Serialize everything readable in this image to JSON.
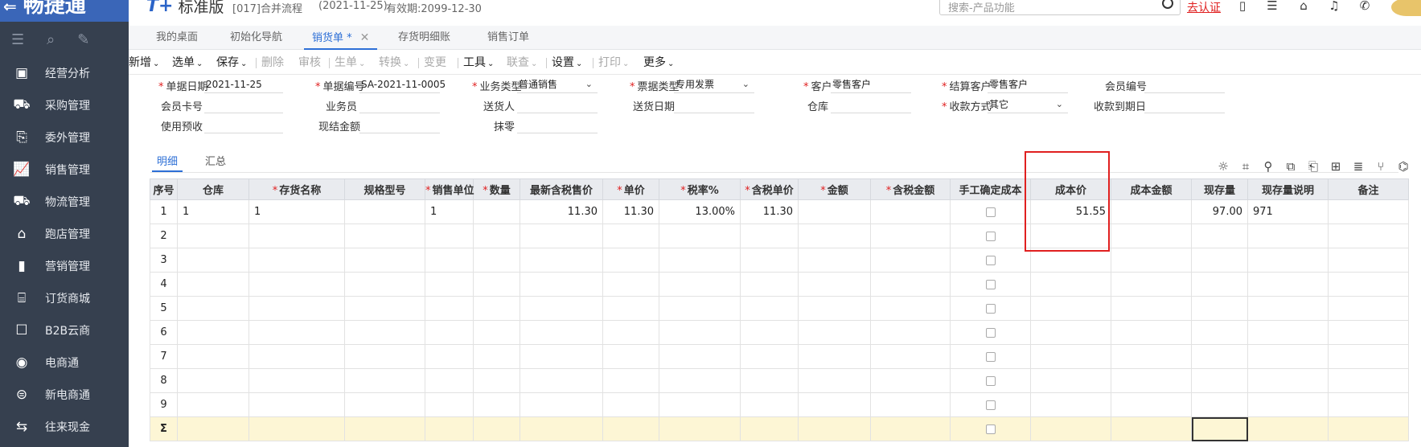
{
  "header": {
    "brand": "畅捷通",
    "edition_logo": "T+",
    "edition_name": "标准版",
    "account": "[017]合并流程",
    "date": "(2021-11-25)",
    "validity": "有效期:2099-12-30",
    "search_placeholder": "搜索-产品功能",
    "auth_link": "去认证"
  },
  "sidebar": {
    "items": [
      {
        "label": "经营分析",
        "icon": "monitor-chart-icon",
        "glyph": "▣"
      },
      {
        "label": "采购管理",
        "icon": "cart-icon",
        "glyph": "⛟"
      },
      {
        "label": "委外管理",
        "icon": "outsource-icon",
        "glyph": "⎘"
      },
      {
        "label": "销售管理",
        "icon": "sales-chart-icon",
        "glyph": "📈"
      },
      {
        "label": "物流管理",
        "icon": "truck-icon",
        "glyph": "⛟"
      },
      {
        "label": "跑店管理",
        "icon": "store-icon",
        "glyph": "⌂"
      },
      {
        "label": "营销管理",
        "icon": "bar-chart-icon",
        "glyph": "▮"
      },
      {
        "label": "订货商城",
        "icon": "shop-icon",
        "glyph": "⌸"
      },
      {
        "label": "B2B云商",
        "icon": "bag-icon",
        "glyph": "☐"
      },
      {
        "label": "电商通",
        "icon": "ecommerce-icon",
        "glyph": "◉"
      },
      {
        "label": "新电商通",
        "icon": "new-ecommerce-icon",
        "glyph": "⊜"
      },
      {
        "label": "往来现金",
        "icon": "exchange-icon",
        "glyph": "⇆"
      }
    ]
  },
  "tabs": [
    {
      "label": "我的桌面"
    },
    {
      "label": "初始化导航"
    },
    {
      "label": "销货单 *"
    },
    {
      "label": "存货明细账"
    },
    {
      "label": "销售订单"
    }
  ],
  "toolbar": [
    {
      "label": "新增",
      "dropdown": true,
      "disabled": false
    },
    {
      "label": "选单",
      "dropdown": true,
      "disabled": false
    },
    {
      "label": "保存",
      "dropdown": true,
      "disabled": false
    },
    {
      "label": "删除",
      "dropdown": false,
      "disabled": true
    },
    {
      "label": "审核",
      "dropdown": false,
      "disabled": true
    },
    {
      "label": "生单",
      "dropdown": true,
      "disabled": true
    },
    {
      "label": "转换",
      "dropdown": true,
      "disabled": true
    },
    {
      "label": "变更",
      "dropdown": false,
      "disabled": true
    },
    {
      "label": "工具",
      "dropdown": true,
      "disabled": false
    },
    {
      "label": "联查",
      "dropdown": true,
      "disabled": true
    },
    {
      "label": "设置",
      "dropdown": true,
      "disabled": false
    },
    {
      "label": "打印",
      "dropdown": true,
      "disabled": true
    },
    {
      "label": "更多",
      "dropdown": true,
      "disabled": false
    }
  ],
  "form": {
    "doc_date": {
      "label": "单据日期",
      "value": "2021-11-25"
    },
    "doc_no": {
      "label": "单据编号",
      "value": "SA-2021-11-0005"
    },
    "biz_type": {
      "label": "业务类型",
      "value": "普通销售"
    },
    "invoice_type": {
      "label": "票据类型",
      "value": "专用发票"
    },
    "customer": {
      "label": "客户",
      "value": "零售客户"
    },
    "settle_customer": {
      "label": "结算客户",
      "value": "零售客户"
    },
    "member_no": {
      "label": "会员编号",
      "value": ""
    },
    "member_card": {
      "label": "会员卡号",
      "value": ""
    },
    "salesman": {
      "label": "业务员",
      "value": ""
    },
    "deliverer": {
      "label": "送货人",
      "value": ""
    },
    "delivery_date": {
      "label": "送货日期",
      "value": ""
    },
    "warehouse": {
      "label": "仓库",
      "value": ""
    },
    "payment_method": {
      "label": "收款方式",
      "value": "其它"
    },
    "due_date": {
      "label": "收款到期日",
      "value": ""
    },
    "use_prepay": {
      "label": "使用预收",
      "value": ""
    },
    "cash_amount": {
      "label": "现结金额",
      "value": ""
    },
    "round_off": {
      "label": "抹零",
      "value": ""
    }
  },
  "subtabs": [
    {
      "label": "明细"
    },
    {
      "label": "汇总"
    }
  ],
  "grid": {
    "columns": [
      {
        "label": "序号",
        "required": false
      },
      {
        "label": "仓库",
        "required": false
      },
      {
        "label": "存货名称",
        "required": true
      },
      {
        "label": "规格型号",
        "required": false
      },
      {
        "label": "销售单位",
        "required": true
      },
      {
        "label": "数量",
        "required": true
      },
      {
        "label": "最新含税售价",
        "required": false
      },
      {
        "label": "单价",
        "required": true
      },
      {
        "label": "税率%",
        "required": true
      },
      {
        "label": "含税单价",
        "required": true
      },
      {
        "label": "金额",
        "required": true
      },
      {
        "label": "含税金额",
        "required": true
      },
      {
        "label": "手工确定成本",
        "required": false
      },
      {
        "label": "成本价",
        "required": false
      },
      {
        "label": "成本金额",
        "required": false
      },
      {
        "label": "现存量",
        "required": false
      },
      {
        "label": "现存量说明",
        "required": false
      },
      {
        "label": "备注",
        "required": false
      }
    ],
    "rows": [
      [
        "1",
        "1",
        "1",
        "",
        "1",
        "",
        "11.30",
        "11.30",
        "13.00%",
        "11.30",
        "",
        "",
        "",
        "51.55",
        "",
        "97.00",
        "971",
        ""
      ],
      [
        "2",
        "",
        "",
        "",
        "",
        "",
        "",
        "",
        "",
        "",
        "",
        "",
        "",
        "",
        "",
        "",
        "",
        ""
      ],
      [
        "3",
        "",
        "",
        "",
        "",
        "",
        "",
        "",
        "",
        "",
        "",
        "",
        "",
        "",
        "",
        "",
        "",
        ""
      ],
      [
        "4",
        "",
        "",
        "",
        "",
        "",
        "",
        "",
        "",
        "",
        "",
        "",
        "",
        "",
        "",
        "",
        "",
        ""
      ],
      [
        "5",
        "",
        "",
        "",
        "",
        "",
        "",
        "",
        "",
        "",
        "",
        "",
        "",
        "",
        "",
        "",
        "",
        ""
      ],
      [
        "6",
        "",
        "",
        "",
        "",
        "",
        "",
        "",
        "",
        "",
        "",
        "",
        "",
        "",
        "",
        "",
        "",
        ""
      ],
      [
        "7",
        "",
        "",
        "",
        "",
        "",
        "",
        "",
        "",
        "",
        "",
        "",
        "",
        "",
        "",
        "",
        "",
        ""
      ],
      [
        "8",
        "",
        "",
        "",
        "",
        "",
        "",
        "",
        "",
        "",
        "",
        "",
        "",
        "",
        "",
        "",
        "",
        ""
      ],
      [
        "9",
        "",
        "",
        "",
        "",
        "",
        "",
        "",
        "",
        "",
        "",
        "",
        "",
        "",
        "",
        "",
        "",
        ""
      ]
    ],
    "sum_row_icon": "sum-icon"
  },
  "colors": {
    "sidebar_bg": "#36404f",
    "accent": "#2d6fd6",
    "required": "#e02020",
    "highlight_box": "#e02020",
    "sum_row_bg": "#fdf6d5"
  }
}
